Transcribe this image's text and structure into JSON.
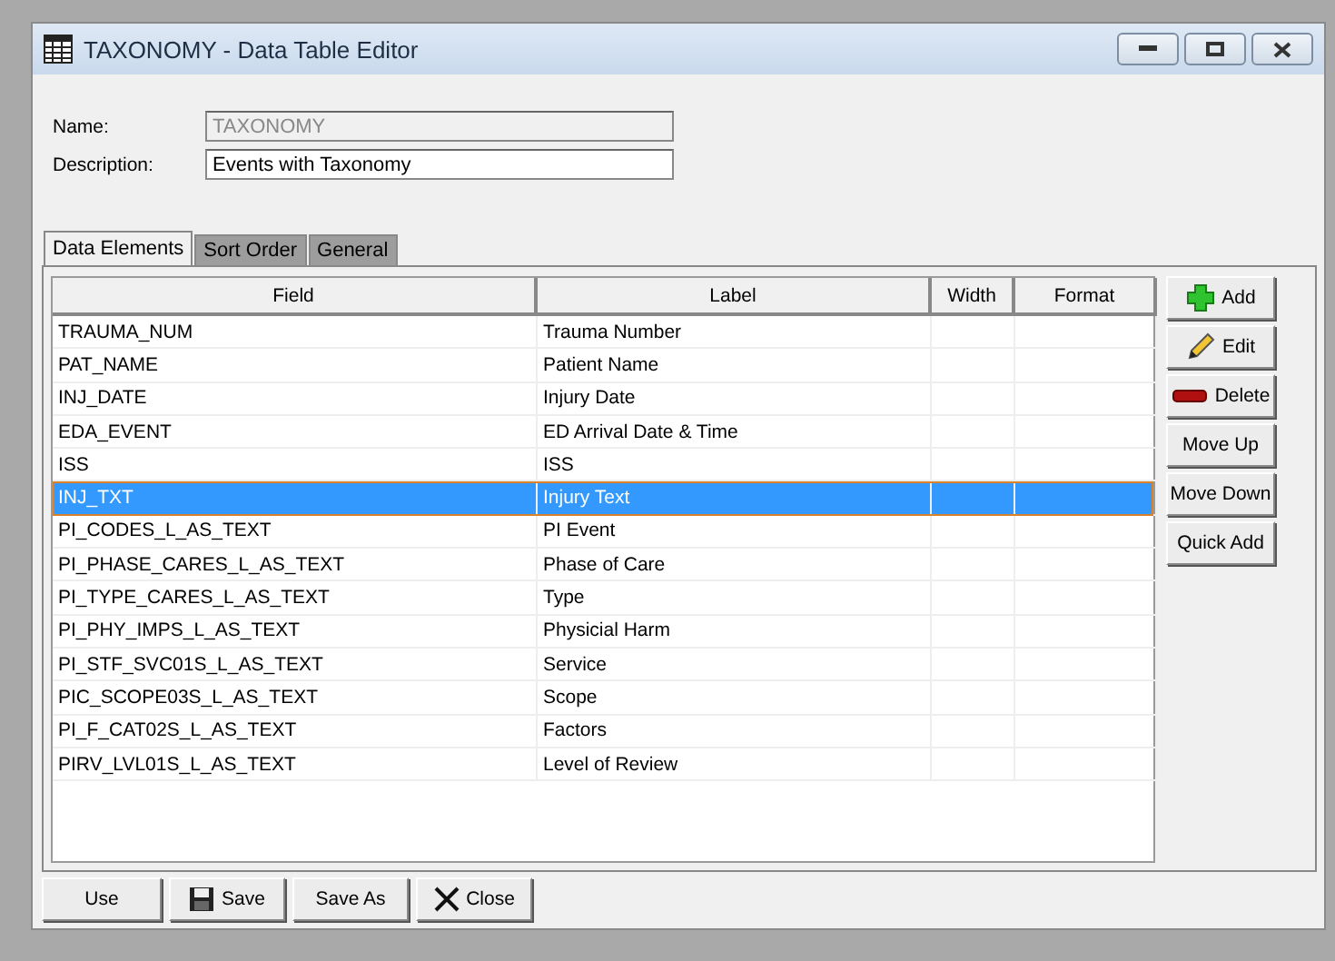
{
  "window": {
    "title": "TAXONOMY - Data Table Editor"
  },
  "form": {
    "name": {
      "label": "Name:",
      "value": "TAXONOMY",
      "disabled": true
    },
    "description": {
      "label": "Description:",
      "value": "Events with Taxonomy",
      "disabled": false
    }
  },
  "tabs": [
    {
      "label": "Data Elements",
      "selected": true
    },
    {
      "label": "Sort Order",
      "selected": false
    },
    {
      "label": "General",
      "selected": false
    }
  ],
  "table": {
    "columns": [
      "Field",
      "Label",
      "Width",
      "Format"
    ],
    "rows": [
      {
        "field": "TRAUMA_NUM",
        "label": "Trauma Number",
        "selected": false
      },
      {
        "field": "PAT_NAME",
        "label": "Patient Name",
        "selected": false
      },
      {
        "field": "INJ_DATE",
        "label": "Injury Date",
        "selected": false
      },
      {
        "field": "EDA_EVENT",
        "label": "ED Arrival Date & Time",
        "selected": false
      },
      {
        "field": "ISS",
        "label": "ISS",
        "selected": false
      },
      {
        "field": "INJ_TXT",
        "label": "Injury Text",
        "selected": true
      },
      {
        "field": "PI_CODES_L_AS_TEXT",
        "label": "PI Event",
        "selected": false
      },
      {
        "field": "PI_PHASE_CARES_L_AS_TEXT",
        "label": "Phase of Care",
        "selected": false
      },
      {
        "field": "PI_TYPE_CARES_L_AS_TEXT",
        "label": "Type",
        "selected": false
      },
      {
        "field": "PI_PHY_IMPS_L_AS_TEXT",
        "label": "Physicial Harm",
        "selected": false
      },
      {
        "field": "PI_STF_SVC01S_L_AS_TEXT",
        "label": "Service",
        "selected": false
      },
      {
        "field": "PIC_SCOPE03S_L_AS_TEXT",
        "label": "Scope",
        "selected": false
      },
      {
        "field": "PI_F_CAT02S_L_AS_TEXT",
        "label": "Factors",
        "selected": false
      },
      {
        "field": "PIRV_LVL01S_L_AS_TEXT",
        "label": "Level of Review",
        "selected": false
      }
    ]
  },
  "side_buttons": [
    {
      "label": "Add",
      "kind": "add"
    },
    {
      "label": "Edit",
      "kind": "edit"
    },
    {
      "label": "Delete",
      "kind": "delete"
    },
    {
      "label": "Move Up",
      "kind": "plain"
    },
    {
      "label": "Move Down",
      "kind": "plain"
    },
    {
      "label": "Quick Add",
      "kind": "plain"
    }
  ],
  "bottom_buttons": [
    {
      "label": "Use",
      "kind": "plain"
    },
    {
      "label": "Save",
      "kind": "save"
    },
    {
      "label": "Save As",
      "kind": "plain"
    },
    {
      "label": "Close",
      "kind": "close"
    }
  ]
}
